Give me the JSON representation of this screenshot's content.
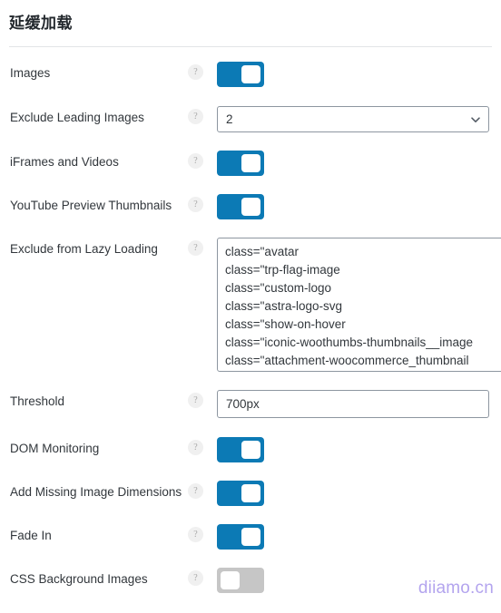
{
  "panel": {
    "title": "延缓加载"
  },
  "rows": [
    {
      "label": "Images",
      "help": "?",
      "type": "toggle",
      "state": "on"
    },
    {
      "label": "Exclude Leading Images",
      "help": "?",
      "type": "select",
      "value": "2",
      "icon": "chevron-down-icon"
    },
    {
      "label": "iFrames and Videos",
      "help": "?",
      "type": "toggle",
      "state": "on"
    },
    {
      "label": "YouTube Preview Thumbnails",
      "help": "?",
      "type": "toggle",
      "state": "on"
    },
    {
      "label": "Exclude from Lazy Loading",
      "help": "?",
      "type": "textarea",
      "value": "class=\"avatar\nclass=\"trp-flag-image\nclass=\"custom-logo\nclass=\"astra-logo-svg\nclass=\"show-on-hover\nclass=\"iconic-woothumbs-thumbnails__image\nclass=\"attachment-woocommerce_thumbnail\nclass=\"attachment-shop_catalog"
    },
    {
      "label": "Threshold",
      "help": "?",
      "type": "text",
      "value": "700px"
    },
    {
      "label": "DOM Monitoring",
      "help": "?",
      "type": "toggle",
      "state": "on"
    },
    {
      "label": "Add Missing Image Dimensions",
      "help": "?",
      "type": "toggle",
      "state": "on"
    },
    {
      "label": "Fade In",
      "help": "?",
      "type": "toggle",
      "state": "on"
    },
    {
      "label": "CSS Background Images",
      "help": "?",
      "type": "toggle",
      "state": "off"
    }
  ],
  "watermark": {
    "text": "diiamo.cn",
    "color": "#b3a4ee"
  },
  "colors": {
    "toggle_on": "#0c7ab5",
    "toggle_off": "#c6c6c6",
    "title": "#23282d",
    "label": "#32373c",
    "border": "#8d96a0"
  }
}
